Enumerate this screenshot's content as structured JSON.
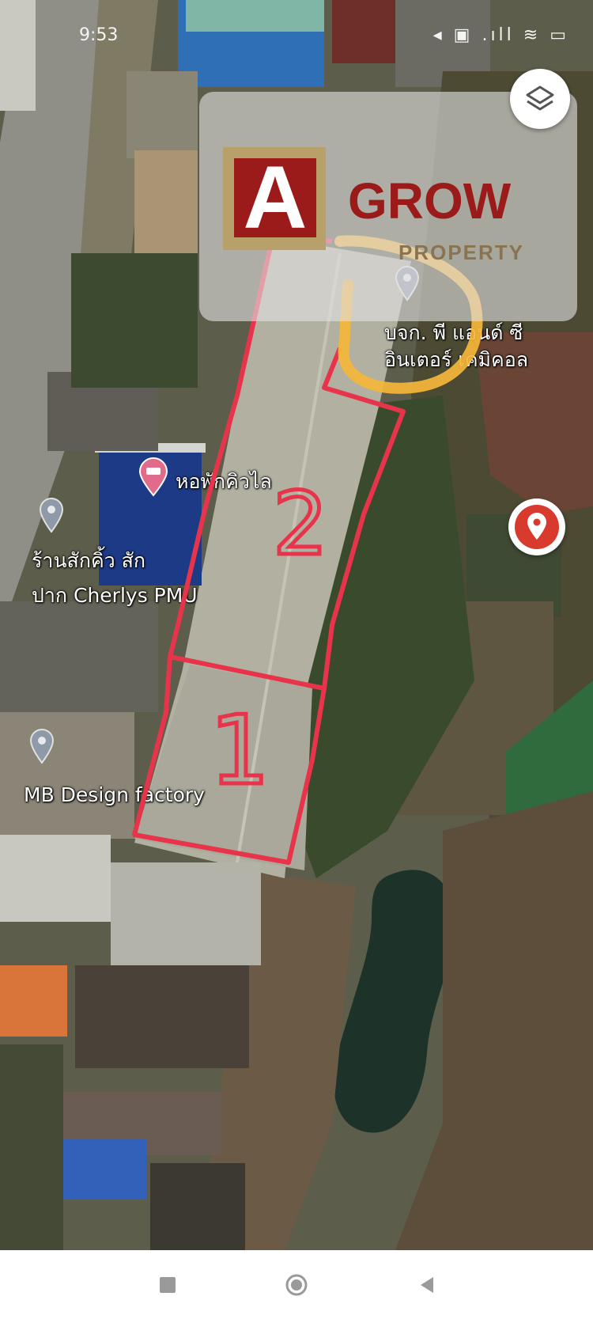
{
  "status_bar": {
    "time": "9:53",
    "icons": "◂ ▣ .ıll ≋ ▭"
  },
  "watermark": {
    "logo_letter": "A",
    "brand_name": "GROW",
    "brand_subtitle": "PROPERTY",
    "brand_color": "#9b1b1b"
  },
  "map": {
    "labels": {
      "company_line1": "บจก. พี แอนด์ ซี",
      "company_line2": "อินเตอร์ เคมิคอล",
      "dorm": "หอพักคิวไล",
      "shop_line1": "ร้านสักคิ้ว สัก",
      "shop_line2": "ปาก Cherlys PMU",
      "factory": "MB Design factory"
    },
    "pin_color": "#d93a2e"
  },
  "annotations": {
    "zone_1": "1",
    "zone_2": "2",
    "outline_color": "#e8344b",
    "highlight_color": "#f5b63a"
  },
  "navigation_bar": {
    "recent_icon": "square",
    "home_icon": "circle",
    "back_icon": "triangle-left"
  }
}
